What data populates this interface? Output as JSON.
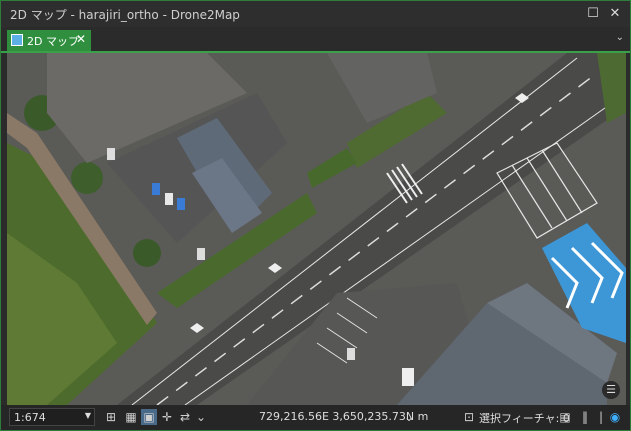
{
  "window": {
    "title": "2D マップ - harajiri_ortho - Drone2Map"
  },
  "tabs": [
    {
      "label": "2D マップ",
      "active": true
    }
  ],
  "status": {
    "scale": "1:674",
    "coordinates": "729,216.56E 3,650,235.73N m",
    "selected_features": "選択フィーチャ: 0"
  },
  "colors": {
    "accent": "#2f8f3e",
    "roof": "#5e6a78",
    "pattern_blue": "#3d97d6"
  }
}
